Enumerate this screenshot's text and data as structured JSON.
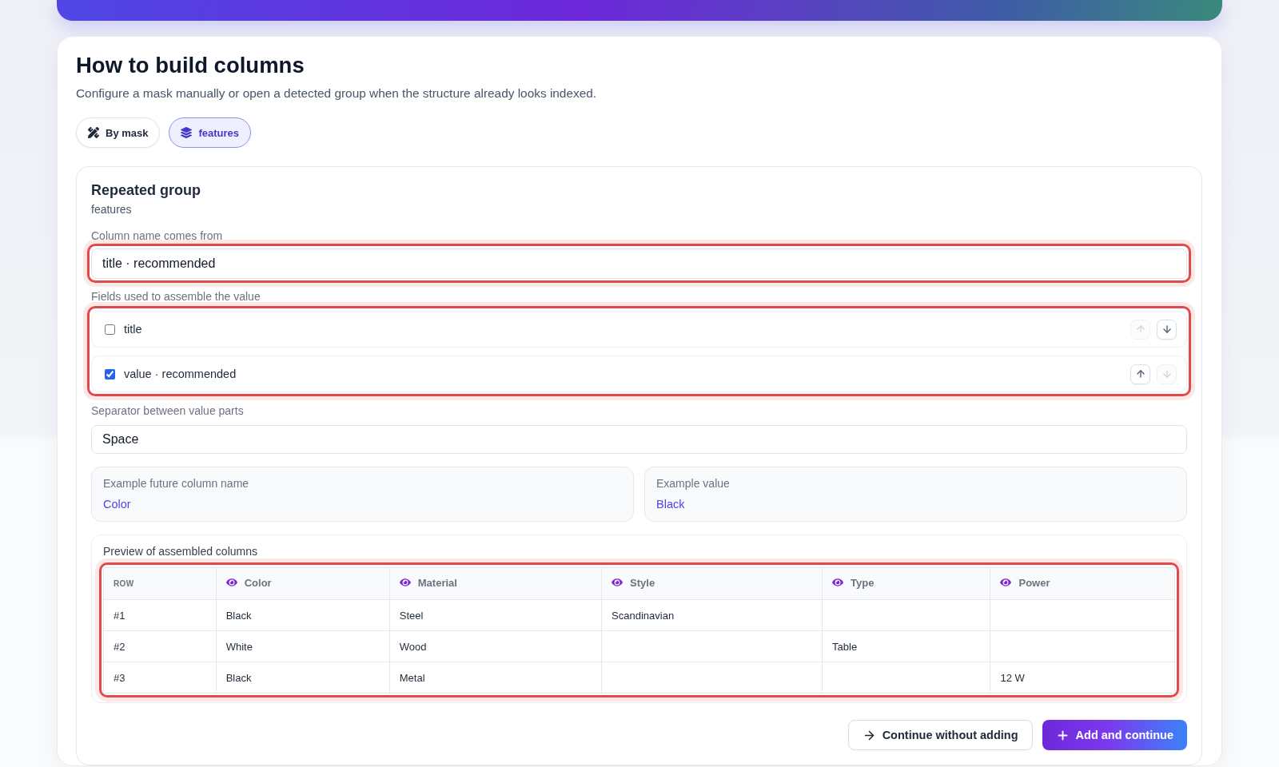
{
  "header": {
    "title": "How to build columns",
    "subtitle": "Configure a mask manually or open a detected group when the structure already looks indexed."
  },
  "modes": [
    {
      "label": "By mask",
      "kind": "mask",
      "selected": false
    },
    {
      "label": "features",
      "kind": "group",
      "selected": true
    }
  ],
  "group_panel": {
    "title": "Repeated group",
    "group_name": "features",
    "column_name": {
      "label": "Column name comes from",
      "value": "title · recommended",
      "highlighted": true
    },
    "value_fields": {
      "label": "Fields used to assemble the value",
      "highlighted": true,
      "items": [
        {
          "label": "title",
          "checked": false,
          "up_disabled": true,
          "down_disabled": false
        },
        {
          "label": "value · recommended",
          "checked": true,
          "up_disabled": false,
          "down_disabled": true
        }
      ]
    },
    "separator": {
      "label": "Separator between value parts",
      "value": "Space"
    },
    "examples": [
      {
        "label": "Example future column name",
        "value": "Color"
      },
      {
        "label": "Example value",
        "value": "Black"
      }
    ],
    "preview": {
      "title": "Preview of assembled columns",
      "highlighted": true,
      "columns": [
        {
          "label": "ROW",
          "kind": "index"
        },
        {
          "label": "Color",
          "kind": "field"
        },
        {
          "label": "Material",
          "kind": "field"
        },
        {
          "label": "Style",
          "kind": "field"
        },
        {
          "label": "Type",
          "kind": "field"
        },
        {
          "label": "Power",
          "kind": "field"
        }
      ],
      "rows": [
        {
          "cells": [
            "#1",
            "Black",
            "Steel",
            "Scandinavian",
            null,
            null
          ]
        },
        {
          "cells": [
            "#2",
            "White",
            "Wood",
            null,
            "Table",
            null
          ]
        },
        {
          "cells": [
            "#3",
            "Black",
            "Metal",
            null,
            null,
            "12 W"
          ]
        }
      ]
    },
    "actions": [
      {
        "label": "Continue without adding",
        "kind": "secondary"
      },
      {
        "label": "Add and continue",
        "kind": "primary"
      }
    ]
  }
}
